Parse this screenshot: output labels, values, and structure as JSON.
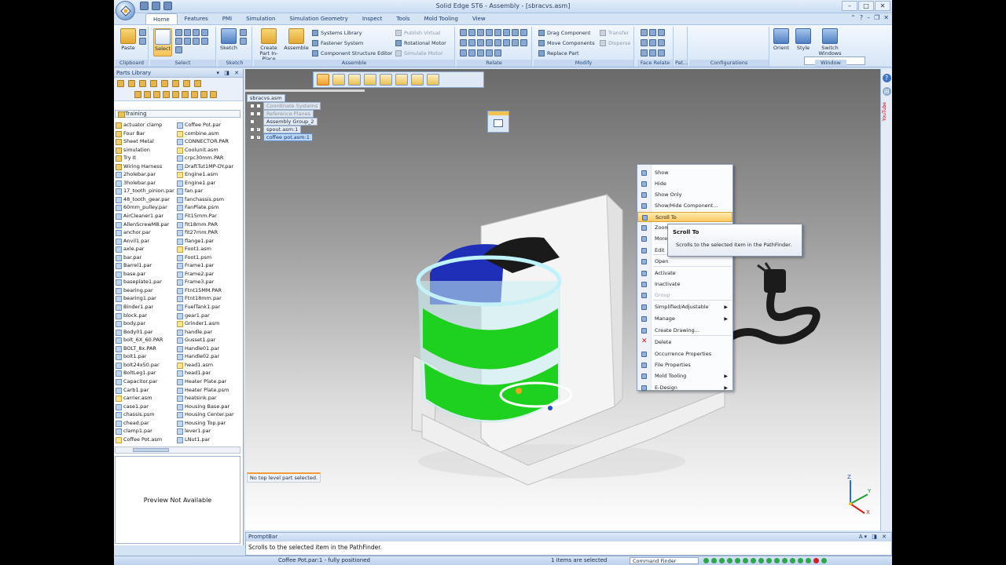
{
  "window": {
    "title": "Solid Edge ST6 - Assembly - [sbracvs.asm]",
    "controls": [
      "–",
      "□",
      "✕"
    ]
  },
  "ribbon": {
    "tabs": [
      "Home",
      "Features",
      "PMI",
      "Simulation",
      "Simulation Geometry",
      "Inspect",
      "Tools",
      "Mold Tooling",
      "View"
    ],
    "groups": {
      "clipboard": {
        "label": "Clipboard",
        "paste": "Paste"
      },
      "select": {
        "label": "Select",
        "select": "Select"
      },
      "sketch": {
        "label": "Sketch",
        "sketch": "Sketch"
      },
      "assemble": {
        "label": "Assemble",
        "create_part": "Create Part In-Place",
        "assemble": "Assemble",
        "items": [
          "Systems Library",
          "Fastener System",
          "Component Structure Editor",
          "Publish Virtual",
          "Rotational Motor",
          "Simulate Motor"
        ]
      },
      "relate": {
        "label": "Relate"
      },
      "modify": {
        "label": "Modify",
        "items": [
          "Drag Component",
          "Move Components",
          "Replace Part",
          "Transfer",
          "Disperse"
        ]
      },
      "face_relate": {
        "label": "Face Relate"
      },
      "pat": {
        "label": "Pat..."
      },
      "configurations": {
        "label": "Configurations"
      },
      "window": {
        "label": "Window",
        "orient": "Orient",
        "style": "Style",
        "switch": "Switch Windows"
      }
    }
  },
  "parts_library": {
    "title": "Parts Library",
    "folder": "Training",
    "col1": [
      "actuator clamp",
      "Four Bar",
      "Sheet Metal",
      "simulation",
      "Try It",
      "Wiring Harness",
      "2holebar.par",
      "3holebar.par",
      "17_tooth_pinion.par",
      "48_tooth_gear.par",
      "60mm_pulley.par",
      "AirCleaner1.par",
      "AllenScrewM8.par",
      "anchor.par",
      "Anvil1.par",
      "axle.par",
      "bar.par",
      "Barrel1.par",
      "base.par",
      "baseplate1.par",
      "bearing.par",
      "bearing1.par",
      "Binder1.par",
      "block.par",
      "body.par",
      "Body01.par",
      "bolt_6X_60.PAR",
      "BOLT_8x.PAR",
      "bolt1.par",
      "bolt24x50.par",
      "BoltLeg1.par",
      "Capacitor.par",
      "Carb1.par",
      "carrier.asm",
      "case1.par",
      "chassis.psm",
      "chead.par",
      "clamp1.par",
      "Coffee Pot.asm"
    ],
    "col2": [
      "Coffee Pot.par",
      "combine.asm",
      "CONNECTOR.PAR",
      "Coolunit.asm",
      "crpc30mm.PAR",
      "DraftTut1MP-DY.par",
      "Engine1.asm",
      "Engine1.par",
      "fan.par",
      "fanchassis.psm",
      "FanPlate.psm",
      "Fit15mm.Par",
      "fit18mm.PAR",
      "fit27mm.PAR",
      "flange1.par",
      "Foot1.asm",
      "Foot1.psm",
      "Frame1.par",
      "Frame2.par",
      "Frame3.par",
      "Ftnt15MM.PAR",
      "Ftnt18mm.par",
      "FuelTank1.par",
      "gear1.par",
      "Grinder1.asm",
      "handle.par",
      "Gusset1.par",
      "Handle01.par",
      "Handle02.par",
      "head1.asm",
      "head1.par",
      "Heater Plate.par",
      "Heater Plate.psm",
      "heatsink.par",
      "Housing Base.par",
      "Housing Center.par",
      "Housing Top.par",
      "lever1.par",
      "LNut1.par"
    ],
    "preview": "Preview Not Available"
  },
  "pathfinder": {
    "root": "sbracvs.asm",
    "nodes": [
      {
        "label": "Coordinate Systems",
        "style": "grey",
        "checked": ""
      },
      {
        "label": "Reference Planes",
        "style": "grey",
        "checked": ""
      },
      {
        "label": "Assembly Group_2",
        "style": "",
        "checked": null
      },
      {
        "label": "spout.asm:1",
        "style": "",
        "checked": "✓"
      },
      {
        "label": "coffee pot.asm:1",
        "style": "hl",
        "checked": "✓"
      }
    ]
  },
  "context_menu": {
    "items": [
      {
        "label": "Show"
      },
      {
        "label": "Hide"
      },
      {
        "label": "Show Only"
      },
      {
        "label": "Show/Hide Component..."
      },
      {
        "label": "Scroll To",
        "hot": true
      },
      {
        "label": "Zoom"
      },
      {
        "label": "More"
      },
      {
        "label": "Edit"
      },
      {
        "label": "Open"
      },
      {
        "label": "Activate"
      },
      {
        "label": "Inactivate"
      },
      {
        "label": "Group",
        "disabled": true
      },
      {
        "label": "Simplified/Adjustable",
        "sub": true
      },
      {
        "label": "Manage",
        "sub": true
      },
      {
        "label": "Create Drawing..."
      },
      {
        "label": "Delete",
        "red": true
      },
      {
        "label": "Occurrence Properties"
      },
      {
        "label": "File Properties"
      },
      {
        "label": "Mold Tooling",
        "sub": true
      },
      {
        "label": "E-Design",
        "sub": true
      }
    ]
  },
  "tooltip": {
    "title": "Scroll To",
    "desc": "Scrolls to the selected item in the PathFinder."
  },
  "viewport": {
    "status": "No top level part selected.",
    "axes": {
      "z": "Z",
      "y": "Y",
      "x": "X"
    }
  },
  "rightbar": {
    "youtube": "YouTube"
  },
  "prompt_bar": {
    "title": "PromptBar",
    "text": "Scrolls to the selected item in the PathFinder."
  },
  "status_bar": {
    "file": "Coffee Pot.par:1 - fully positioned",
    "selected": "1 items are selected",
    "command_finder": "Command Finder"
  }
}
